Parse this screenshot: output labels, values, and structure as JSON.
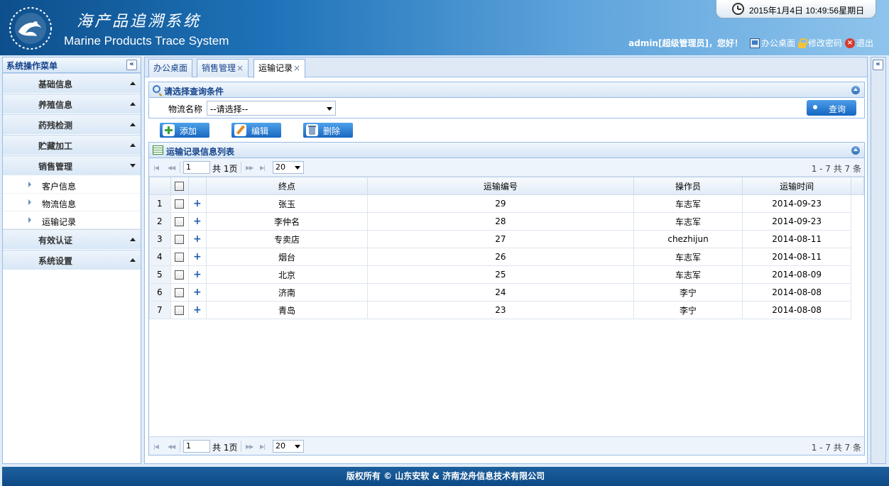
{
  "header": {
    "title_cn": "海产品追溯系统",
    "title_en": "Marine Products Trace System",
    "datetime": "2015年1月4日  10:49:56星期日",
    "greeting": "admin[超级管理员]，您好！",
    "links": {
      "desktop": "办公桌面",
      "change_password": "修改密码",
      "logout": "退出"
    }
  },
  "sidebar": {
    "title": "系统操作菜单",
    "sections": [
      {
        "label": "基础信息"
      },
      {
        "label": "养殖信息"
      },
      {
        "label": "药残检测"
      },
      {
        "label": "贮藏加工"
      },
      {
        "label": "销售管理",
        "sub": [
          "客户信息",
          "物流信息",
          "运输记录"
        ]
      },
      {
        "label": "有效认证"
      },
      {
        "label": "系统设置"
      }
    ]
  },
  "tabs": [
    {
      "label": "办公桌面"
    },
    {
      "label": "销售管理"
    },
    {
      "label": "运输记录"
    }
  ],
  "query": {
    "title": "请选择查询条件",
    "field_label": "物流名称",
    "select_value": "--请选择--",
    "button": "查询"
  },
  "toolbar": {
    "add": "添加",
    "edit": "编辑",
    "delete": "删除"
  },
  "list": {
    "title": "运输记录信息列表",
    "pager": {
      "page": "1",
      "total_prefix": "共",
      "total_pages": "1页",
      "page_size": "20",
      "info": "1 - 7  共 7 条"
    },
    "columns": [
      "终点",
      "运输编号",
      "操作员",
      "运输时间"
    ],
    "rows": [
      {
        "n": "1",
        "dest": "张玉",
        "no": "29",
        "op": "车志军",
        "time": "2014-09-23"
      },
      {
        "n": "2",
        "dest": "李仲名",
        "no": "28",
        "op": "车志军",
        "time": "2014-09-23"
      },
      {
        "n": "3",
        "dest": "专卖店",
        "no": "27",
        "op": "chezhijun",
        "time": "2014-08-11"
      },
      {
        "n": "4",
        "dest": "烟台",
        "no": "26",
        "op": "车志军",
        "time": "2014-08-11"
      },
      {
        "n": "5",
        "dest": "北京",
        "no": "25",
        "op": "车志军",
        "time": "2014-08-09"
      },
      {
        "n": "6",
        "dest": "济南",
        "no": "24",
        "op": "李宁",
        "time": "2014-08-08"
      },
      {
        "n": "7",
        "dest": "青岛",
        "no": "23",
        "op": "李宁",
        "time": "2014-08-08"
      }
    ]
  },
  "footer": "版权所有  © 山东安软  & 济南龙舟信息技术有限公司"
}
